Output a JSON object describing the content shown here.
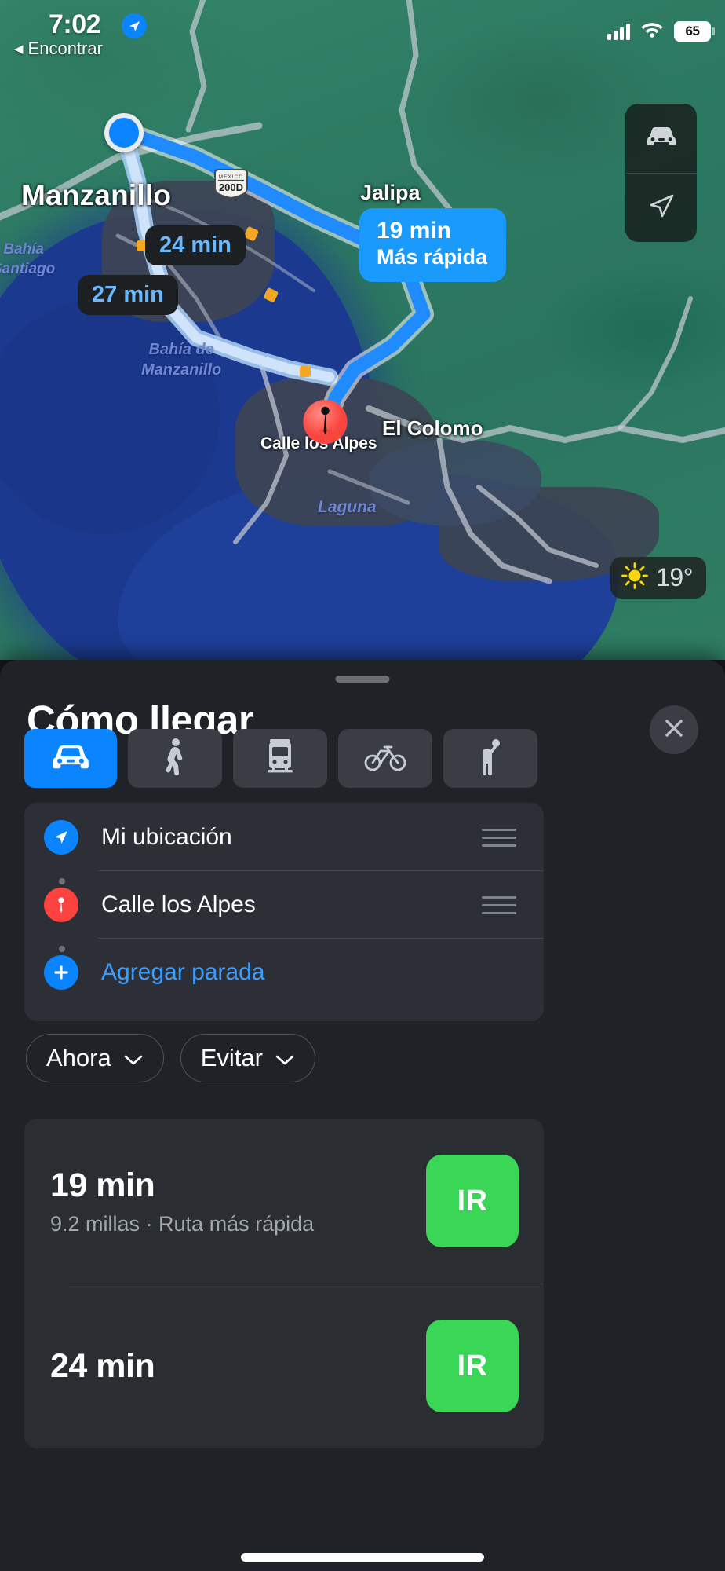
{
  "status_bar": {
    "time": "7:02",
    "location_arrow_icon": "navigation-arrow-icon",
    "back_label": "Encontrar",
    "back_arrow": "◀",
    "cellular_icon": "cellular-bars-icon",
    "wifi_icon": "wifi-icon",
    "battery_percent": "65"
  },
  "map": {
    "labels": {
      "manzanillo": "Manzanillo",
      "jalipa": "Jalipa",
      "el_colomo": "El Colomo",
      "calle_los_alpes": "Calle los Alpes",
      "bahia_santiago_line1": "Bahía",
      "bahia_santiago_line2": "Santiago",
      "bahia_manzanillo_line1": "Bahía de",
      "bahia_manzanillo_line2": "Manzanillo",
      "laguna": "Laguna"
    },
    "highway_shield": {
      "country": "MEXICO",
      "number": "200D"
    },
    "route_callouts": [
      {
        "time": "24 min",
        "style": "dark"
      },
      {
        "time": "27 min",
        "style": "dark"
      },
      {
        "time": "19 min",
        "subtitle": "Más rápida",
        "style": "blue-selected"
      }
    ],
    "controls": [
      {
        "name": "driving-conditions-button",
        "icon": "car-icon"
      },
      {
        "name": "recenter-button",
        "icon": "navigation-arrow-icon"
      }
    ],
    "weather": {
      "icon": "sun-icon",
      "temperature": "19°"
    },
    "destination_pin_icon": "map-pin-icon",
    "user_location_icon": "user-location-dot"
  },
  "sheet": {
    "title": "Cómo llegar",
    "close_icon": "close-icon",
    "grabber": "drag-handle",
    "modes": [
      {
        "name": "driving",
        "icon": "car-icon",
        "selected": true
      },
      {
        "name": "walking",
        "icon": "walk-icon",
        "selected": false
      },
      {
        "name": "transit",
        "icon": "train-icon",
        "selected": false
      },
      {
        "name": "cycling",
        "icon": "bicycle-icon",
        "selected": false
      },
      {
        "name": "ride-share",
        "icon": "person-hailing-icon",
        "selected": false
      }
    ],
    "route_fields": [
      {
        "icon": "navigation-arrow-icon",
        "value": "Mi ubicación",
        "reorder": "reorder-handle"
      },
      {
        "icon": "map-pin-icon",
        "value": "Calle los Alpes",
        "reorder": "reorder-handle"
      },
      {
        "icon": "plus-icon",
        "value": "Agregar parada",
        "is_link": true
      }
    ],
    "option_chips": [
      {
        "label": "Ahora",
        "icon": "chevron-down-icon"
      },
      {
        "label": "Evitar",
        "icon": "chevron-down-icon"
      }
    ],
    "routes": [
      {
        "time": "19 min",
        "details": "9.2 millas · Ruta más rápida",
        "go_label": "IR"
      },
      {
        "time": "24 min",
        "details": "",
        "go_label": "IR"
      }
    ]
  },
  "colors": {
    "accent_blue": "#0a84ff",
    "go_green": "#3ad655",
    "pin_red": "#fd4340",
    "sheet_bg": "#1f2227",
    "callout_dark": "#1d2023"
  }
}
